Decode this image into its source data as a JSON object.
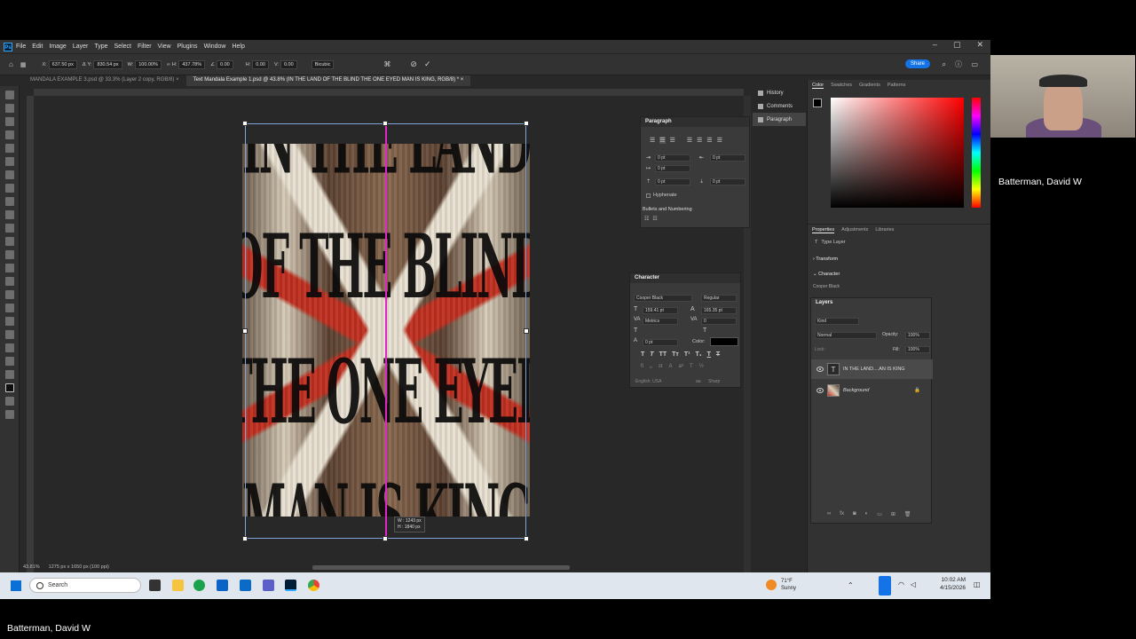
{
  "menu": {
    "logo": "Ps",
    "items": [
      "File",
      "Edit",
      "Image",
      "Layer",
      "Type",
      "Select",
      "Filter",
      "View",
      "Plugins",
      "Window",
      "Help"
    ]
  },
  "window_controls": {
    "minimize": "–",
    "maximize": "▢",
    "close": "✕"
  },
  "options_bar": {
    "x_label": "X:",
    "x": "637.50 px",
    "y_label": "Y:",
    "y": "830.54 px",
    "w_label": "W:",
    "w": "100.00%",
    "h_label": "H:",
    "h": "437.78%",
    "angle": "0.00",
    "hskew_label": "H:",
    "hskew": "0.00",
    "vskew_label": "V:",
    "vskew": "0.00",
    "interp": "Bicubic",
    "share": "Share"
  },
  "tabs": [
    {
      "label": "MANDALA EXAMPLE 3.psd @ 33.3% (Layer 2 copy, RGB/8)"
    },
    {
      "label": "Text Mandala Example 1.psd @ 43.8% (IN THE LAND OF THE BLIND THE ONE EYED MAN IS KING, RGB/8) *"
    }
  ],
  "canvas": {
    "lines": [
      "IN THE LAND",
      "OF THE BLIND",
      "THE ONE EYED",
      "MAN IS KING"
    ],
    "dim_w": "W : 1243 px",
    "dim_h": "H : 1840 px"
  },
  "status": {
    "zoom": "43.81%",
    "doc": "1275 px x 1650 px (100 ppi)"
  },
  "side_strip": {
    "history": "History",
    "comments": "Comments",
    "paragraph": "Paragraph"
  },
  "paragraph_panel": {
    "title": "Paragraph",
    "indent_left": "0 pt",
    "indent_right": "0 pt",
    "first_line": "0 pt",
    "space_before": "0 pt",
    "space_after": "0 pt",
    "hyphenate": "Hyphenate",
    "bullets": "Bullets and Numbering"
  },
  "character_panel": {
    "title": "Character",
    "font": "Cooper Black",
    "style": "Regular",
    "size": "159.41 pt",
    "leading": "165.35 pt",
    "kerning": "Metrics",
    "tracking": "0",
    "baseline": "0 pt",
    "color_label": "Color:",
    "language": "English: USA",
    "aa": "Sharp",
    "aa_icon": "aa"
  },
  "color_panel": {
    "tabs": [
      "Color",
      "Swatches",
      "Gradients",
      "Patterns"
    ]
  },
  "properties_panel": {
    "tabs": [
      "Properties",
      "Adjustments",
      "Libraries"
    ],
    "type_layer": "Type Layer",
    "transform": "Transform",
    "character": "Character",
    "font": "Cooper Black"
  },
  "layers_panel": {
    "title": "Layers",
    "search": "Kind",
    "blend": "Normal",
    "opacity_label": "Opacity:",
    "opacity": "100%",
    "lock_label": "Lock:",
    "fill_label": "Fill:",
    "fill": "100%",
    "layers": [
      {
        "name": "IN THE LAND....AN IS KING",
        "thumb": "T"
      },
      {
        "name": "Background",
        "thumb": ""
      }
    ]
  },
  "taskbar": {
    "search": "Search",
    "weather_temp": "71°F",
    "weather_desc": "Sunny",
    "time": "10:02 AM",
    "date": "4/15/2026"
  },
  "participant": {
    "name_right": "Batterman, David W",
    "name_bottom": "Batterman, David W"
  }
}
